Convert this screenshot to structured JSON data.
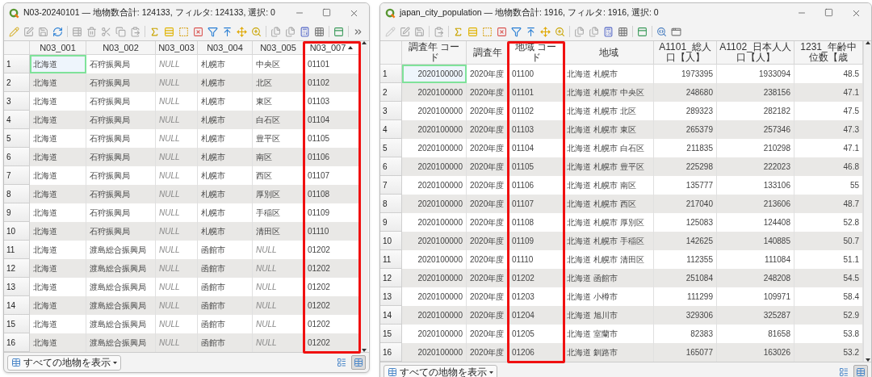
{
  "windows": [
    {
      "title": "N03-20240101 — 地物数合計: 124133, フィルタ: 124133, 選択: 0",
      "columns": [
        {
          "label": "N03_001",
          "kind": "text",
          "highlighted": false,
          "sorted": false
        },
        {
          "label": "N03_002",
          "kind": "text",
          "highlighted": false,
          "sorted": false
        },
        {
          "label": "N03_003",
          "kind": "text",
          "highlighted": false,
          "sorted": false
        },
        {
          "label": "N03_004",
          "kind": "text",
          "highlighted": false,
          "sorted": false
        },
        {
          "label": "N03_005",
          "kind": "text",
          "highlighted": false,
          "sorted": false
        },
        {
          "label": "N03_007",
          "kind": "text",
          "highlighted": true,
          "sorted": true
        }
      ],
      "rows": [
        {
          "number": "1",
          "current": true,
          "cells": [
            "北海道",
            "石狩振興局",
            {
              "text": "NULL",
              "is_null": true
            },
            "札幌市",
            "中央区",
            "01101"
          ]
        },
        {
          "number": "2",
          "current": false,
          "cells": [
            "北海道",
            "石狩振興局",
            {
              "text": "NULL",
              "is_null": true
            },
            "札幌市",
            "北区",
            "01102"
          ]
        },
        {
          "number": "3",
          "current": false,
          "cells": [
            "北海道",
            "石狩振興局",
            {
              "text": "NULL",
              "is_null": true
            },
            "札幌市",
            "東区",
            "01103"
          ]
        },
        {
          "number": "4",
          "current": false,
          "cells": [
            "北海道",
            "石狩振興局",
            {
              "text": "NULL",
              "is_null": true
            },
            "札幌市",
            "白石区",
            "01104"
          ]
        },
        {
          "number": "5",
          "current": false,
          "cells": [
            "北海道",
            "石狩振興局",
            {
              "text": "NULL",
              "is_null": true
            },
            "札幌市",
            "豊平区",
            "01105"
          ]
        },
        {
          "number": "6",
          "current": false,
          "cells": [
            "北海道",
            "石狩振興局",
            {
              "text": "NULL",
              "is_null": true
            },
            "札幌市",
            "南区",
            "01106"
          ]
        },
        {
          "number": "7",
          "current": false,
          "cells": [
            "北海道",
            "石狩振興局",
            {
              "text": "NULL",
              "is_null": true
            },
            "札幌市",
            "西区",
            "01107"
          ]
        },
        {
          "number": "8",
          "current": false,
          "cells": [
            "北海道",
            "石狩振興局",
            {
              "text": "NULL",
              "is_null": true
            },
            "札幌市",
            "厚別区",
            "01108"
          ]
        },
        {
          "number": "9",
          "current": false,
          "cells": [
            "北海道",
            "石狩振興局",
            {
              "text": "NULL",
              "is_null": true
            },
            "札幌市",
            "手稲区",
            "01109"
          ]
        },
        {
          "number": "10",
          "current": false,
          "cells": [
            "北海道",
            "石狩振興局",
            {
              "text": "NULL",
              "is_null": true
            },
            "札幌市",
            "清田区",
            "01110"
          ]
        },
        {
          "number": "11",
          "current": false,
          "cells": [
            "北海道",
            "渡島総合振興局",
            {
              "text": "NULL",
              "is_null": true
            },
            "函館市",
            {
              "text": "NULL",
              "is_null": true
            },
            "01202"
          ]
        },
        {
          "number": "12",
          "current": false,
          "cells": [
            "北海道",
            "渡島総合振興局",
            {
              "text": "NULL",
              "is_null": true
            },
            "函館市",
            {
              "text": "NULL",
              "is_null": true
            },
            "01202"
          ]
        },
        {
          "number": "13",
          "current": false,
          "cells": [
            "北海道",
            "渡島総合振興局",
            {
              "text": "NULL",
              "is_null": true
            },
            "函館市",
            {
              "text": "NULL",
              "is_null": true
            },
            "01202"
          ]
        },
        {
          "number": "14",
          "current": false,
          "cells": [
            "北海道",
            "渡島総合振興局",
            {
              "text": "NULL",
              "is_null": true
            },
            "函館市",
            {
              "text": "NULL",
              "is_null": true
            },
            "01202"
          ]
        },
        {
          "number": "15",
          "current": false,
          "cells": [
            "北海道",
            "渡島総合振興局",
            {
              "text": "NULL",
              "is_null": true
            },
            "函館市",
            {
              "text": "NULL",
              "is_null": true
            },
            "01202"
          ]
        },
        {
          "number": "16",
          "current": false,
          "cells": [
            "北海道",
            "渡島総合振興局",
            {
              "text": "NULL",
              "is_null": true
            },
            "函館市",
            {
              "text": "NULL",
              "is_null": true
            },
            "01202"
          ]
        }
      ],
      "footer": {
        "filter_button": "すべての地物を表示",
        "views": [
          {
            "selected": false
          },
          {
            "selected": true
          }
        ]
      }
    },
    {
      "title": "japan_city_population — 地物数合計: 1916, フィルタ: 1916, 選択: 0",
      "columns": [
        {
          "label": "調査年 コード",
          "kind": "number",
          "highlighted": false,
          "sorted": false
        },
        {
          "label": "調査年",
          "kind": "text",
          "highlighted": false,
          "sorted": false
        },
        {
          "label": "地域 コード",
          "kind": "text",
          "highlighted": true,
          "sorted": false
        },
        {
          "label": "地域",
          "kind": "text",
          "highlighted": false,
          "sorted": false
        },
        {
          "label": "A1101_総人口【人】",
          "kind": "number",
          "highlighted": false,
          "sorted": false
        },
        {
          "label": "A1102_日本人人口【人】",
          "kind": "number",
          "highlighted": false,
          "sorted": false
        },
        {
          "label": "1231_年齢中位数【歳",
          "kind": "number",
          "highlighted": false,
          "sorted": false
        }
      ],
      "rows": [
        {
          "number": "1",
          "current": true,
          "cells": [
            "2020100000",
            "2020年度",
            "01100",
            "北海道 札幌市",
            "1973395",
            "1933094",
            "48.5"
          ]
        },
        {
          "number": "2",
          "current": false,
          "cells": [
            "2020100000",
            "2020年度",
            "01101",
            "北海道 札幌市 中央区",
            "248680",
            "238156",
            "47.1"
          ]
        },
        {
          "number": "3",
          "current": false,
          "cells": [
            "2020100000",
            "2020年度",
            "01102",
            "北海道 札幌市 北区",
            "289323",
            "282182",
            "47.5"
          ]
        },
        {
          "number": "4",
          "current": false,
          "cells": [
            "2020100000",
            "2020年度",
            "01103",
            "北海道 札幌市 東区",
            "265379",
            "257346",
            "47.3"
          ]
        },
        {
          "number": "5",
          "current": false,
          "cells": [
            "2020100000",
            "2020年度",
            "01104",
            "北海道 札幌市 白石区",
            "211835",
            "210298",
            "47.1"
          ]
        },
        {
          "number": "6",
          "current": false,
          "cells": [
            "2020100000",
            "2020年度",
            "01105",
            "北海道 札幌市 豊平区",
            "225298",
            "222023",
            "46.8"
          ]
        },
        {
          "number": "7",
          "current": false,
          "cells": [
            "2020100000",
            "2020年度",
            "01106",
            "北海道 札幌市 南区",
            "135777",
            "133106",
            "55"
          ]
        },
        {
          "number": "8",
          "current": false,
          "cells": [
            "2020100000",
            "2020年度",
            "01107",
            "北海道 札幌市 西区",
            "217040",
            "213606",
            "48.7"
          ]
        },
        {
          "number": "9",
          "current": false,
          "cells": [
            "2020100000",
            "2020年度",
            "01108",
            "北海道 札幌市 厚別区",
            "125083",
            "124408",
            "52.8"
          ]
        },
        {
          "number": "10",
          "current": false,
          "cells": [
            "2020100000",
            "2020年度",
            "01109",
            "北海道 札幌市 手稲区",
            "142625",
            "140885",
            "50.7"
          ]
        },
        {
          "number": "11",
          "current": false,
          "cells": [
            "2020100000",
            "2020年度",
            "01110",
            "北海道 札幌市 清田区",
            "112355",
            "111084",
            "51.1"
          ]
        },
        {
          "number": "12",
          "current": false,
          "cells": [
            "2020100000",
            "2020年度",
            "01202",
            "北海道 函館市",
            "251084",
            "248208",
            "54.5"
          ]
        },
        {
          "number": "13",
          "current": false,
          "cells": [
            "2020100000",
            "2020年度",
            "01203",
            "北海道 小樽市",
            "111299",
            "109971",
            "58.4"
          ]
        },
        {
          "number": "14",
          "current": false,
          "cells": [
            "2020100000",
            "2020年度",
            "01204",
            "北海道 旭川市",
            "329306",
            "325287",
            "52.9"
          ]
        },
        {
          "number": "15",
          "current": false,
          "cells": [
            "2020100000",
            "2020年度",
            "01205",
            "北海道 室蘭市",
            "82383",
            "81658",
            "53.8"
          ]
        },
        {
          "number": "16",
          "current": false,
          "cells": [
            "2020100000",
            "2020年度",
            "01206",
            "北海道 釧路市",
            "165077",
            "163026",
            "53.2"
          ]
        }
      ],
      "footer": {
        "filter_button": "すべての地物を表示",
        "views": [
          {
            "selected": false
          },
          {
            "selected": true
          }
        ]
      }
    }
  ]
}
